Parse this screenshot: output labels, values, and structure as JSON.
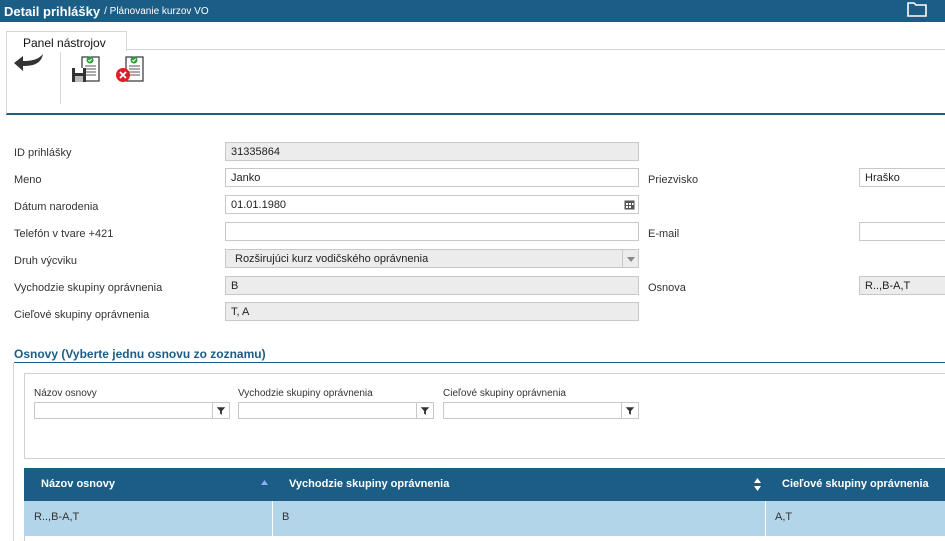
{
  "titlebar": {
    "title": "Detail prihlášky",
    "subtitle": "/ Plánovanie kurzov VO",
    "icon": "folder-icon"
  },
  "toolbar": {
    "tab_label": "Panel nástrojov",
    "icons": [
      "back-arrow-icon",
      "save-form-icon",
      "cancel-form-icon"
    ]
  },
  "form": {
    "id_label": "ID prihlášky",
    "id_value": "31335864",
    "meno_label": "Meno",
    "meno_value": "Janko",
    "priezvisko_label": "Priezvisko",
    "priezvisko_value": "Hraško",
    "datum_label": "Dátum narodenia",
    "datum_value": "01.01.1980",
    "telefon_label": "Telefón v tvare +421",
    "telefon_value": "",
    "email_label": "E-mail",
    "email_value": "",
    "druh_label": "Druh výcviku",
    "druh_value": "Rozširujúci kurz vodičského oprávnenia",
    "vychodzie_label": "Vychodzie skupiny oprávnenia",
    "vychodzie_value": "B",
    "osnova_label": "Osnova",
    "osnova_value": "R..,B-A,T",
    "cielove_label": "Cieľové skupiny oprávnenia",
    "cielove_value": "T, A"
  },
  "osnovy": {
    "section_title": "Osnovy (Vyberte jednu osnovu zo zoznamu)",
    "filters": {
      "nazov_label": "Názov osnovy",
      "vychodzie_label": "Vychodzie skupiny oprávnenia",
      "cielove_label": "Cieľové skupiny oprávnenia"
    },
    "columns": [
      "Názov osnovy",
      "Vychodzie skupiny oprávnenia",
      "Cieľové skupiny oprávnenia"
    ],
    "rows": [
      {
        "nazov": "R..,B-A,T",
        "vychodzie": "B",
        "cielove": "A,T"
      }
    ]
  },
  "colors": {
    "primary": "#1c5d86",
    "selected_row": "#b3d5ea",
    "readonly_bg": "#ececec"
  }
}
